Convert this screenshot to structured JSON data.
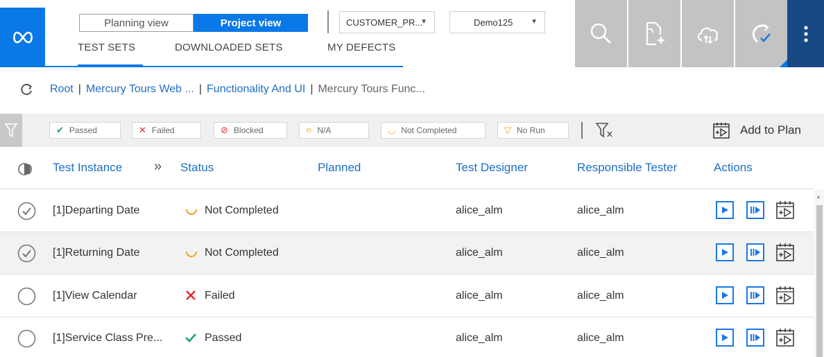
{
  "header": {
    "views": {
      "planning": "Planning view",
      "project": "Project view"
    },
    "tabs": [
      "TEST SETS",
      "DOWNLOADED SETS",
      "MY DEFECTS"
    ],
    "active_tab": "TEST SETS",
    "project_dropdown": "CUSTOMER_PR...",
    "server_dropdown": "Demo125",
    "tools": [
      "search-icon",
      "add-document-icon",
      "cloud-sync-icon",
      "refresh-check-icon"
    ],
    "more_icon": "more-vertical-icon",
    "accent": "#0a78e6",
    "dark_accent": "#174a84"
  },
  "breadcrumb": {
    "items": [
      "Root",
      "Mercury Tours Web ...",
      "Functionality And UI",
      "Mercury Tours Func..."
    ],
    "separator": "|"
  },
  "filters": {
    "chips": [
      {
        "label": "Passed",
        "icon": "check-icon",
        "color": "#1a9e76"
      },
      {
        "label": "Failed",
        "icon": "x-icon",
        "color": "#e5242f"
      },
      {
        "label": "Blocked",
        "icon": "blocked-icon",
        "color": "#e5242f"
      },
      {
        "label": "N/A",
        "icon": "na-icon",
        "color": "#f0a020"
      },
      {
        "label": "Not Completed",
        "icon": "not-completed-icon",
        "color": "#f0a020"
      },
      {
        "label": "No Run",
        "icon": "no-run-icon",
        "color": "#f0a020"
      }
    ],
    "add_to_plan": "Add to Plan"
  },
  "table": {
    "columns": {
      "instance": "Test Instance",
      "status": "Status",
      "planned": "Planned",
      "designer": "Test Designer",
      "tester": "Responsible Tester",
      "actions": "Actions"
    },
    "rows": [
      {
        "checked": true,
        "instance": "[1]Departing Date",
        "status": "Not Completed",
        "status_icon": "not-completed-icon",
        "planned": "",
        "designer": "alice_alm",
        "tester": "alice_alm"
      },
      {
        "checked": true,
        "instance": "[1]Returning Date",
        "status": "Not Completed",
        "status_icon": "not-completed-icon",
        "planned": "",
        "designer": "alice_alm",
        "tester": "alice_alm"
      },
      {
        "checked": false,
        "instance": "[1]View Calendar",
        "status": "Failed",
        "status_icon": "x-icon",
        "planned": "",
        "designer": "alice_alm",
        "tester": "alice_alm"
      },
      {
        "checked": false,
        "instance": "[1]Service Class Pre...",
        "status": "Passed",
        "status_icon": "check-icon",
        "planned": "",
        "designer": "alice_alm",
        "tester": "alice_alm"
      }
    ]
  }
}
